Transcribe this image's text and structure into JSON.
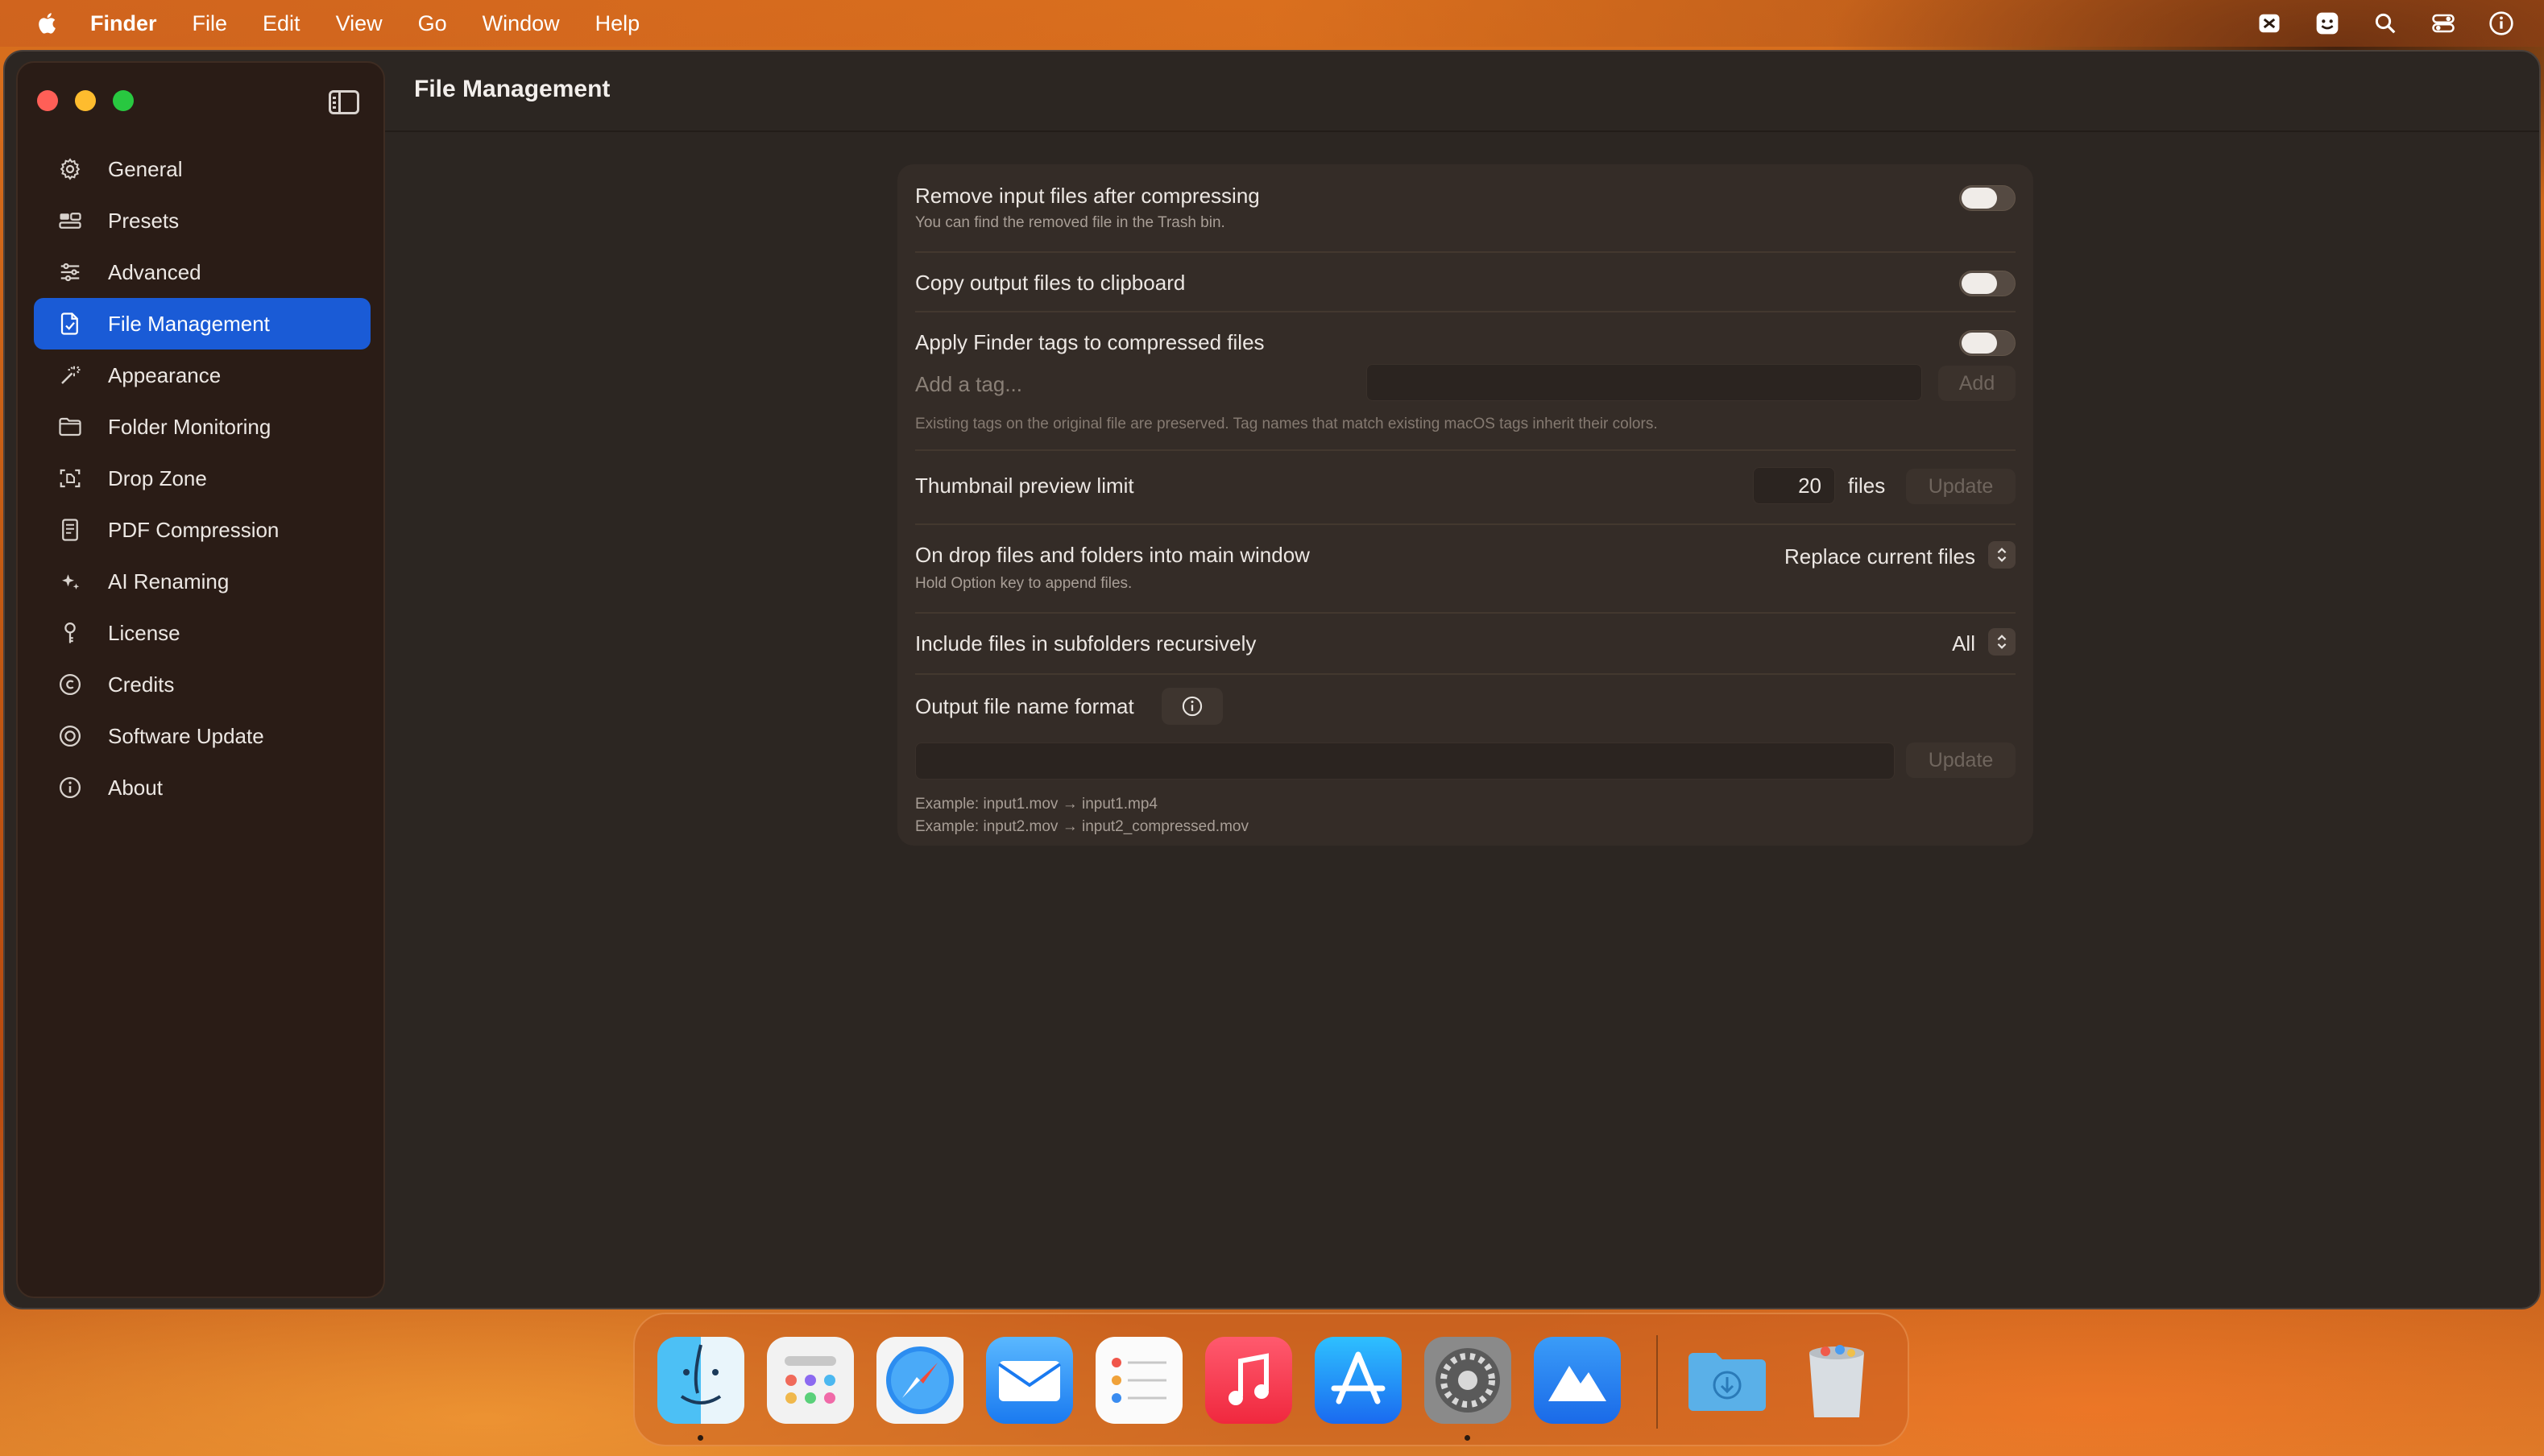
{
  "menubar": {
    "app": "Finder",
    "items": [
      "File",
      "Edit",
      "View",
      "Go",
      "Window",
      "Help"
    ]
  },
  "window": {
    "title": "File Management"
  },
  "sidebar": {
    "items": [
      {
        "label": "General",
        "icon": "gear-icon"
      },
      {
        "label": "Presets",
        "icon": "presets-icon"
      },
      {
        "label": "Advanced",
        "icon": "sliders-icon"
      },
      {
        "label": "File Management",
        "icon": "file-management-icon",
        "active": true
      },
      {
        "label": "Appearance",
        "icon": "magic-wand-icon"
      },
      {
        "label": "Folder Monitoring",
        "icon": "folder-icon"
      },
      {
        "label": "Drop Zone",
        "icon": "drop-zone-icon"
      },
      {
        "label": "PDF Compression",
        "icon": "document-icon"
      },
      {
        "label": "AI Renaming",
        "icon": "sparkles-icon"
      },
      {
        "label": "License",
        "icon": "key-icon"
      },
      {
        "label": "Credits",
        "icon": "copyright-icon"
      },
      {
        "label": "Software Update",
        "icon": "update-icon"
      },
      {
        "label": "About",
        "icon": "info-icon"
      }
    ]
  },
  "settings": {
    "remove_input": {
      "label": "Remove input files after compressing",
      "sub": "You can find the removed file in the Trash bin.",
      "on": false
    },
    "copy_clipboard": {
      "label": "Copy output files to clipboard",
      "on": false
    },
    "finder_tags": {
      "label": "Apply Finder tags to compressed files",
      "on": false,
      "placeholder": "Add a tag...",
      "add_label": "Add",
      "note": "Existing tags on the original file are preserved. Tag names that match existing macOS tags inherit their colors."
    },
    "thumbnail": {
      "label": "Thumbnail preview limit",
      "value": "20",
      "unit": "files",
      "update_label": "Update"
    },
    "on_drop": {
      "label": "On drop files and folders into main window",
      "sub": "Hold Option key to append files.",
      "value": "Replace current files"
    },
    "subfolders": {
      "label": "Include files in subfolders recursively",
      "value": "All"
    },
    "output_format": {
      "label": "Output file name format",
      "update_label": "Update",
      "example1": "Example: input1.mov → input1.mp4",
      "example2": "Example: input2.mov → input2_compressed.mov"
    }
  },
  "dock": {
    "apps": [
      "Finder",
      "Launchpad",
      "Safari",
      "Mail",
      "Reminders",
      "Music",
      "App Store",
      "System Settings",
      "Compressor"
    ],
    "others": [
      "Downloads",
      "Trash"
    ]
  },
  "colors": {
    "accent": "#1a5bd6",
    "window_bg": "#2c2622",
    "sidebar_bg": "#2a1c16",
    "card_bg": "#342c27"
  }
}
